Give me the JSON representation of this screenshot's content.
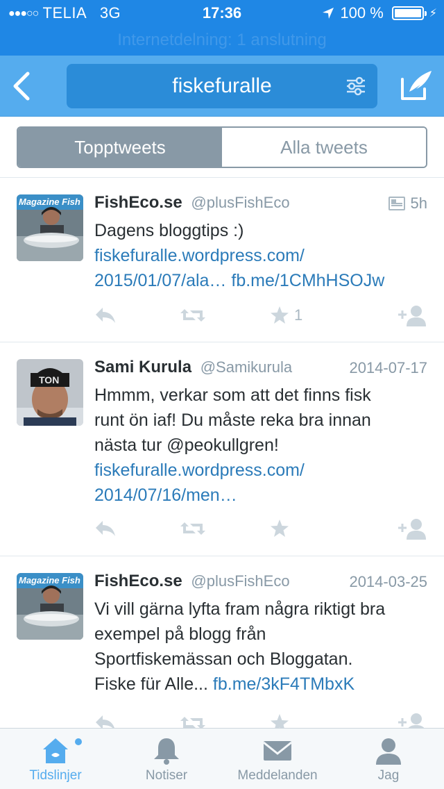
{
  "status_bar": {
    "signal": "●●●○○",
    "carrier": "TELIA",
    "network": "3G",
    "time": "17:36",
    "battery": "100 %",
    "hotspot": "Internetdelning: 1 anslutning"
  },
  "nav": {
    "search_query": "fiskefuralle",
    "icons": [
      "back-chevron-icon",
      "filter-sliders-icon",
      "compose-tweet-icon"
    ]
  },
  "segments": {
    "top": "Topptweets",
    "all": "Alla tweets",
    "selected": "top"
  },
  "tweets": [
    {
      "name": "FishEco.se",
      "handle": "@plusFishEco",
      "time": "5h",
      "has_card": true,
      "text": "Dagens bloggtips :)",
      "link1": "fiskefuralle.wordpress.com/",
      "link2": "2015/01/07/ala…",
      "link3": "fb.me/1CMhHSOJw",
      "fav_count": "1"
    },
    {
      "name": "Sami Kurula",
      "handle": "@Samikurula",
      "time": "2014-07-17",
      "line1": "Hmmm, verkar som att det finns fisk",
      "line2": "runt ön iaf! Du måste reka bra innan",
      "line3": "nästa tur @peokullgren!",
      "link1": "fiskefuralle.wordpress.com/",
      "link2": "2014/07/16/men…"
    },
    {
      "name": "FishEco.se",
      "handle": "@plusFishEco",
      "time": "2014-03-25",
      "line1": "Vi vill gärna lyfta fram några riktigt bra",
      "line2": "exempel på blogg från",
      "line3": "Sportfiskemässan och Bloggatan.",
      "line4": "Fiske für Alle...",
      "link1": "fb.me/3kF4TMbxK"
    }
  ],
  "avatar_text": {
    "fisheco": "Magazine Fish",
    "sami": "TON"
  },
  "tabbar": {
    "home": "Tidslinjer",
    "notifications": "Notiser",
    "messages": "Meddelanden",
    "me": "Jag",
    "active": "home"
  },
  "colors": {
    "header_blue": "#1f87e5",
    "nav_blue": "#55acee",
    "link_blue": "#2b7bb9",
    "muted": "#8899a6"
  }
}
